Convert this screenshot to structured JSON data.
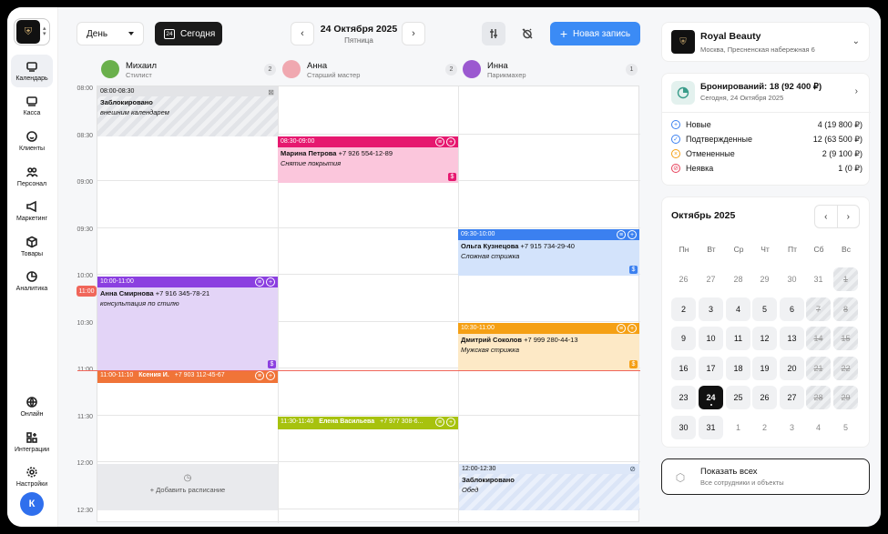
{
  "nav": {
    "items": [
      {
        "label": "Календарь",
        "icon": "calendar-icon"
      },
      {
        "label": "Касса",
        "icon": "register-icon"
      },
      {
        "label": "Клиенты",
        "icon": "smile-icon"
      },
      {
        "label": "Персонал",
        "icon": "people-icon"
      },
      {
        "label": "Маркетинг",
        "icon": "megaphone-icon"
      },
      {
        "label": "Товары",
        "icon": "box-icon"
      },
      {
        "label": "Аналитика",
        "icon": "pie-chart-icon"
      },
      {
        "label": "Онлайн",
        "icon": "globe-icon"
      },
      {
        "label": "Интеграции",
        "icon": "grid-plus-icon"
      },
      {
        "label": "Настройки",
        "icon": "gear-icon"
      }
    ],
    "avatar": "К"
  },
  "toolbar": {
    "view": "День",
    "today": "Сегодня",
    "today_num": "24",
    "date": "24 Октября 2025",
    "weekday": "Пятница",
    "new_label": "Новая запись"
  },
  "staff": [
    {
      "name": "Михаил",
      "role": "Стилист",
      "count": "2"
    },
    {
      "name": "Анна",
      "role": "Старший мастер",
      "count": "2"
    },
    {
      "name": "Инна",
      "role": "Парикмахер",
      "count": "1"
    }
  ],
  "times": [
    "08:00",
    "08:30",
    "09:00",
    "09:30",
    "10:00",
    "10:30",
    "11:00",
    "11:30",
    "12:00",
    "12:30"
  ],
  "now": "11:00",
  "blocks": [
    {
      "time": "08:00-08:30",
      "title": "Заблокировано",
      "note": "внешним календарем"
    },
    {
      "time": "12:00-12:30",
      "title": "Заблокировано",
      "note": "Обед"
    }
  ],
  "add_schedule": "+ Добавить расписание",
  "appointments": [
    {
      "time": "08:30-09:00",
      "client": "Марина Петрова",
      "phone": "+7 926 554-12-89",
      "service": "Снятие покрытия",
      "color": "#e6186f",
      "bg": "#fbc6dc"
    },
    {
      "time": "09:30-10:00",
      "client": "Ольга Кузнецова",
      "phone": "+7 915 734-29-40",
      "service": "Сложная стрижка",
      "color": "#3b80f0",
      "bg": "#d3e3fb"
    },
    {
      "time": "10:00-11:00",
      "client": "Анна Смирнова",
      "phone": "+7 916 345-78-21",
      "service": "консультация по стилю",
      "color": "#8b3fe0",
      "bg": "#e3d4f7"
    },
    {
      "time": "10:30-11:00",
      "client": "Дмитрий Соколов",
      "phone": "+7 999 280-44-13",
      "service": "Мужская стрижка",
      "color": "#f5a014",
      "bg": "#fde9c6"
    },
    {
      "time": "11:00-11:10",
      "client": "Ксения И.",
      "phone": "+7 903 112-45-67",
      "color": "#f07438"
    },
    {
      "time": "11:30-11:40",
      "client": "Елена Васильева",
      "phone": "+7 977 308-6...",
      "color": "#a7c20e"
    }
  ],
  "salon": {
    "name": "Royal Beauty",
    "address": "Москва, Пресненская набережная 6"
  },
  "bookings": {
    "title": "Бронирований: 18 (92 400 ₽)",
    "date": "Сегодня, 24 Октября 2025",
    "stats": [
      {
        "label": "Новые",
        "value": "4 (19 800 ₽)",
        "color": "#3b80f0",
        "glyph": "+"
      },
      {
        "label": "Подтвержденные",
        "value": "12 (63 500 ₽)",
        "color": "#3b80f0",
        "glyph": "✓"
      },
      {
        "label": "Отмененные",
        "value": "2 (9 100 ₽)",
        "color": "#f5a014",
        "glyph": "×"
      },
      {
        "label": "Неявка",
        "value": "1 (0 ₽)",
        "color": "#e6405a",
        "glyph": "⊘"
      }
    ]
  },
  "calendar": {
    "month": "Октябрь 2025",
    "weekdays": [
      "Пн",
      "Вт",
      "Ср",
      "Чт",
      "Пт",
      "Сб",
      "Вс"
    ],
    "weeks": [
      [
        [
          "26",
          "prev"
        ],
        [
          "27",
          "prev"
        ],
        [
          "28",
          "prev"
        ],
        [
          "29",
          "prev"
        ],
        [
          "30",
          "prev"
        ],
        [
          "31",
          "prev"
        ],
        [
          "1",
          "dis"
        ]
      ],
      [
        [
          "2",
          "cur"
        ],
        [
          "3",
          "cur"
        ],
        [
          "4",
          "cur"
        ],
        [
          "5",
          "cur"
        ],
        [
          "6",
          "cur"
        ],
        [
          "7",
          "dis"
        ],
        [
          "8",
          "dis"
        ]
      ],
      [
        [
          "9",
          "cur"
        ],
        [
          "10",
          "cur"
        ],
        [
          "11",
          "cur"
        ],
        [
          "12",
          "cur"
        ],
        [
          "13",
          "cur"
        ],
        [
          "14",
          "dis"
        ],
        [
          "15",
          "dis"
        ]
      ],
      [
        [
          "16",
          "cur"
        ],
        [
          "17",
          "cur"
        ],
        [
          "18",
          "cur"
        ],
        [
          "19",
          "cur"
        ],
        [
          "20",
          "cur"
        ],
        [
          "21",
          "dis"
        ],
        [
          "22",
          "dis"
        ]
      ],
      [
        [
          "23",
          "cur"
        ],
        [
          "24",
          "sel"
        ],
        [
          "25",
          "cur"
        ],
        [
          "26",
          "cur"
        ],
        [
          "27",
          "cur"
        ],
        [
          "28",
          "dis"
        ],
        [
          "29",
          "dis"
        ]
      ],
      [
        [
          "30",
          "cur"
        ],
        [
          "31",
          "cur"
        ],
        [
          "1",
          "prev"
        ],
        [
          "2",
          "prev"
        ],
        [
          "3",
          "prev"
        ],
        [
          "4",
          "prev"
        ],
        [
          "5",
          "prev"
        ]
      ]
    ]
  },
  "show_all": {
    "title": "Показать всех",
    "subtitle": "Все сотрудники и объекты"
  }
}
